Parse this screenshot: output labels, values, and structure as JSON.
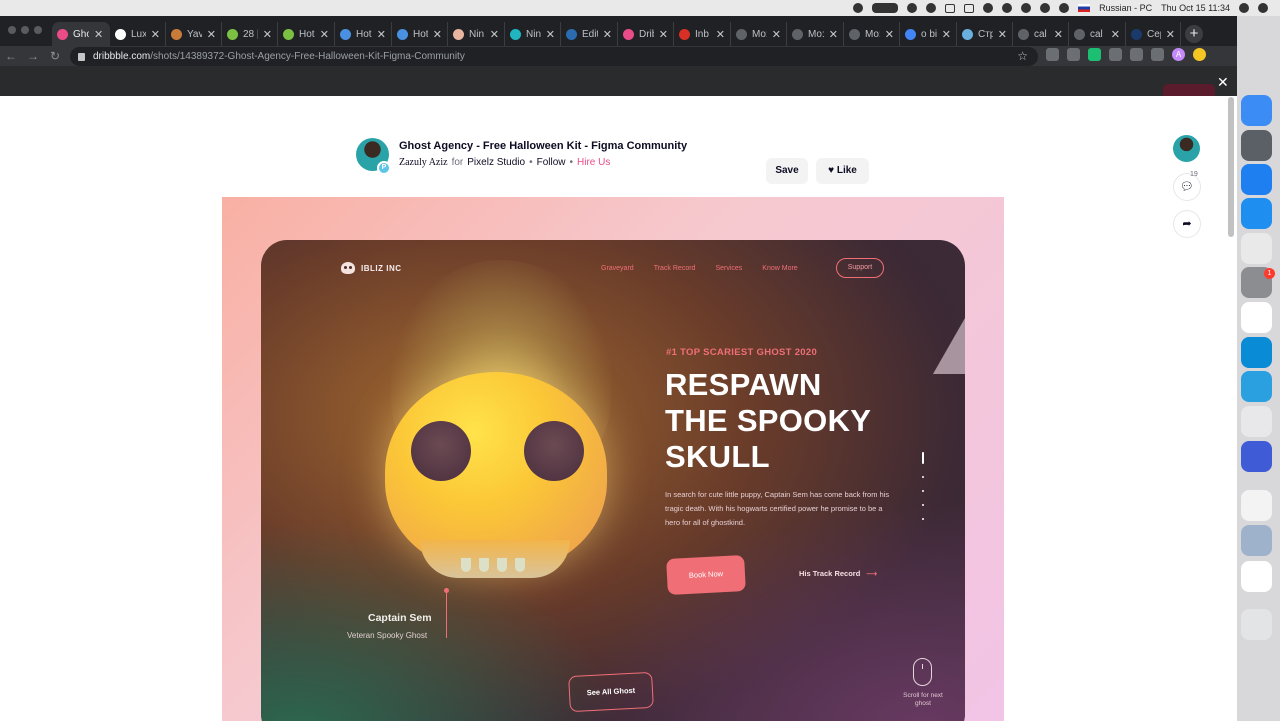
{
  "menubar": {
    "language": "Russian - PC",
    "datetime": "Thu Oct 15  11:34"
  },
  "tabs": [
    {
      "label": "Gho",
      "favicon_color": "#ea4c89",
      "active": true
    },
    {
      "label": "Lux",
      "favicon_color": "#ffffff"
    },
    {
      "label": "Yav",
      "favicon_color": "#c97b3a"
    },
    {
      "label": "28 |",
      "favicon_color": "#7bc043"
    },
    {
      "label": "Hot",
      "favicon_color": "#7bc043"
    },
    {
      "label": "Hot",
      "favicon_color": "#4a90e2"
    },
    {
      "label": "Hot",
      "favicon_color": "#4a90e2"
    },
    {
      "label": "Nin",
      "favicon_color": "#e8b4a0"
    },
    {
      "label": "Nin",
      "favicon_color": "#1fb6c1"
    },
    {
      "label": "Edit",
      "favicon_color": "#2b6cb0"
    },
    {
      "label": "Drib",
      "favicon_color": "#ea4c89"
    },
    {
      "label": "Inb",
      "favicon_color": "#d93025"
    },
    {
      "label": "Mo:",
      "favicon_color": "#5f6368"
    },
    {
      "label": "Mo:",
      "favicon_color": "#5f6368"
    },
    {
      "label": "Mo:",
      "favicon_color": "#5f6368"
    },
    {
      "label": "o bi",
      "favicon_color": "#4285f4"
    },
    {
      "label": "Стр",
      "favicon_color": "#6ab0de"
    },
    {
      "label": "cal",
      "favicon_color": "#5f6368"
    },
    {
      "label": "cal",
      "favicon_color": "#5f6368"
    },
    {
      "label": "Cep",
      "favicon_color": "#1a3a6b"
    }
  ],
  "address": {
    "host": "dribbble.com",
    "path": "/shots/14389372-Ghost-Agency-Free-Halloween-Kit-Figma-Community"
  },
  "shot": {
    "title": "Ghost Agency - Free Halloween Kit - Figma Community",
    "author": "Zazuly Aziz",
    "for_label": "for",
    "studio": "Pixelz Studio",
    "follow": "Follow",
    "hire": "Hire Us",
    "separator": "•",
    "pro_badge": "P",
    "save_label": "Save",
    "like_label": "Like",
    "comment_count": "19"
  },
  "artwork": {
    "brand": "IBLIZ INC",
    "nav": [
      "Graveyard",
      "Track Record",
      "Services",
      "Know More"
    ],
    "support": "Support",
    "eyebrow": "#1 TOP SCARIEST  GHOST 2020",
    "headline": [
      "RESPAWN",
      "THE SPOOKY",
      "SKULL"
    ],
    "copy": "In search for cute little puppy, Captain Sem has come back from his tragic death. With his hogwarts certified power he promise to be a hero for all of ghostkind.",
    "book_now": "Book Now",
    "track_record": "His Track Record",
    "arrow": "⟶",
    "captain_name": "Captain Sem",
    "captain_role": "Veteran Spooky Ghost",
    "see_all": "See All Ghost",
    "scroll_note": "Scroll for next ghost"
  },
  "dock": {
    "badge": "1",
    "apps": [
      "finder-icon",
      "launchpad-icon",
      "safari-icon",
      "app-store-icon",
      "chrome-icon",
      "system-preferences-icon",
      "figma-icon",
      "skype-icon",
      "telegram-icon",
      "screenshot-icon",
      "audio-icon",
      "textedit-icon",
      "preview-icon",
      "g-hub-icon",
      "trash-icon"
    ]
  },
  "colors": {
    "accent": "#ea4c89",
    "art_accent": "#f06f77"
  }
}
